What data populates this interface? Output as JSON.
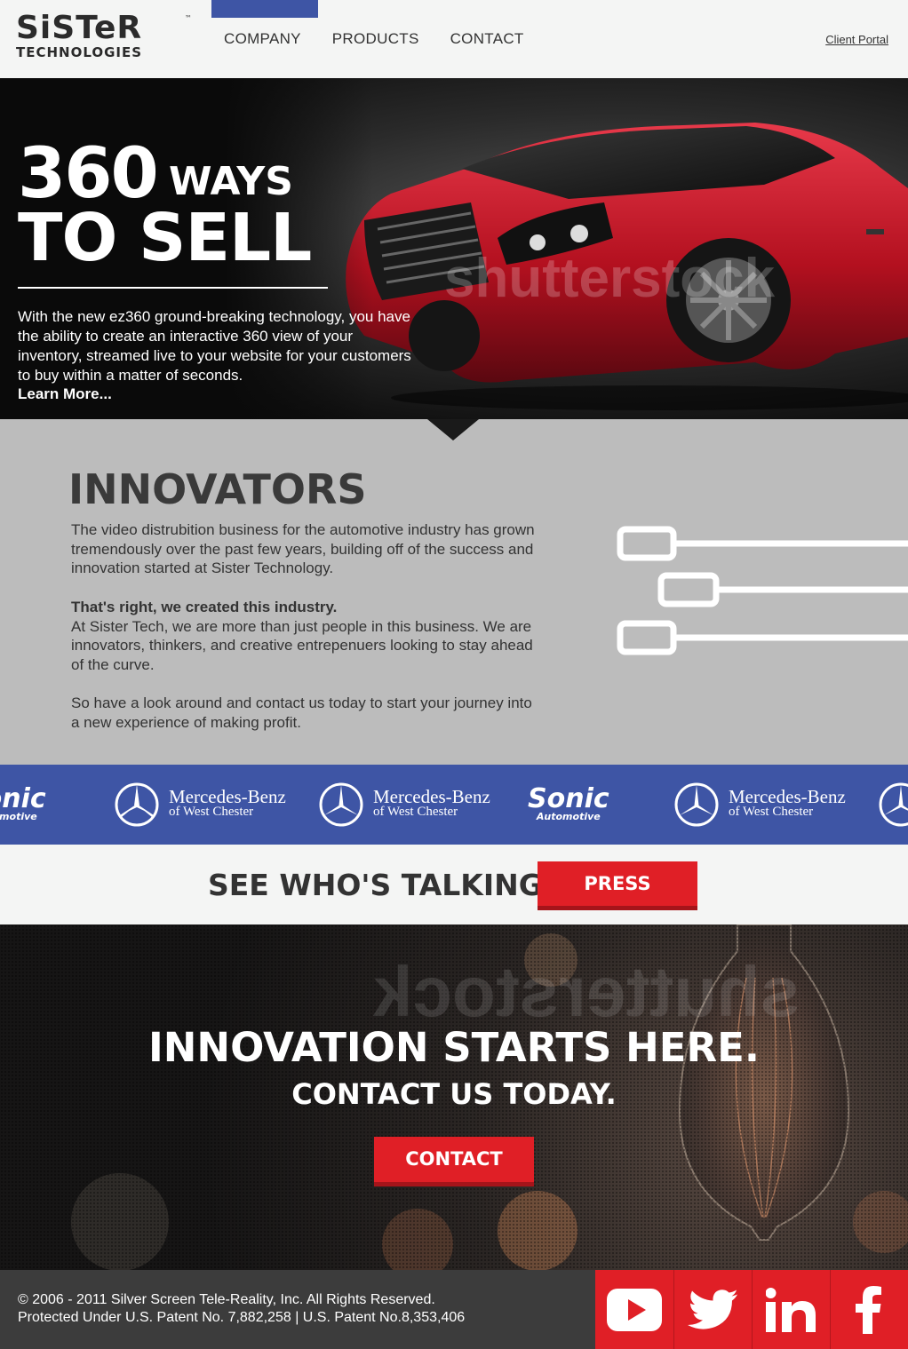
{
  "header": {
    "logo_top": "SiSTeR",
    "logo_tm": "™",
    "logo_bottom": "TECHNOLOGIES",
    "nav": [
      "COMPANY",
      "PRODUCTS",
      "CONTACT"
    ],
    "client_portal": "Client Portal",
    "accent_color": "#3e55a5"
  },
  "hero": {
    "headline_num": "360",
    "headline_ways": "WAYS",
    "headline_sell": "TO SELL",
    "body": "With the new ez360 ground-breaking technology, you have the ability to create an interactive 360 view of your inventory, streamed live to your website for your customers to buy within a matter of seconds.",
    "learn_more": "Learn More...",
    "watermark": "shutterstock"
  },
  "innovators": {
    "title": "INNOVATORS",
    "p1": "The video distrubition business for the automotive industry has grown tremendously over the past few years, building off of the success and innovation started at Sister Technology.",
    "p2_bold": "That's right, we created this industry.",
    "p2": "At Sister Tech, we are more than just people in this business. We are innovators, thinkers, and creative entrepenuers looking to stay ahead of the curve.",
    "p3": "So have a look around and contact us today to start your journey into a new experience of making profit."
  },
  "logos": {
    "sonic_name": "Sonic",
    "sonic_sub": "Automotive",
    "mb_name": "Mercedes-Benz",
    "mb_sub": "of West Chester",
    "strip_color": "#3e55a5"
  },
  "talking": {
    "title": "SEE WHO'S TALKING",
    "button": "PRESS"
  },
  "cta": {
    "title": "INNOVATION STARTS HERE.",
    "subtitle": "CONTACT US TODAY.",
    "button": "CONTACT",
    "watermark": "shutterstock"
  },
  "footer": {
    "line1": "© 2006 - 2011 Silver Screen Tele-Reality, Inc. All Rights Reserved.",
    "line2": "Protected Under U.S. Patent No. 7,882,258 | U.S. Patent No.8,353,406",
    "social": [
      "youtube-icon",
      "twitter-icon",
      "linkedin-icon",
      "facebook-icon"
    ],
    "social_color": "#e01f26"
  }
}
